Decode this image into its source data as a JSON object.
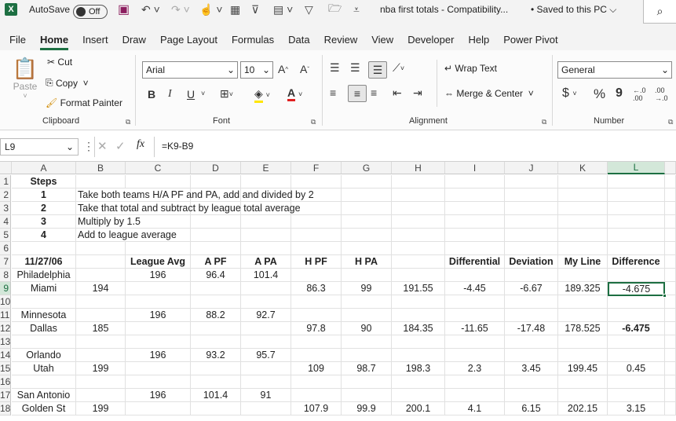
{
  "titlebar": {
    "logo": "X",
    "autosave_label": "AutoSave",
    "autosave_state": "Off",
    "doc_title": "nba first totals  -  Compatibility...",
    "saved_status": "• Saved to this PC",
    "icons": [
      "save-icon",
      "undo-icon",
      "redo-icon",
      "touch-mode-icon",
      "form-icon",
      "filter-clear-icon",
      "sort-icon",
      "filter-icon",
      "open-icon",
      "customize-icon",
      "search-icon"
    ]
  },
  "menu": {
    "tabs": [
      "File",
      "Home",
      "Insert",
      "Draw",
      "Page Layout",
      "Formulas",
      "Data",
      "Review",
      "View",
      "Developer",
      "Help",
      "Power Pivot"
    ],
    "active": "Home"
  },
  "ribbon": {
    "clipboard": {
      "paste": "Paste",
      "cut": "Cut",
      "copy": "Copy",
      "format_painter": "Format Painter",
      "group": "Clipboard"
    },
    "font": {
      "name": "Arial",
      "size": "10",
      "group": "Font",
      "bold": "B",
      "italic": "I",
      "underline": "U",
      "grow": "A^",
      "shrink": "Aˇ"
    },
    "alignment": {
      "wrap": "Wrap Text",
      "merge": "Merge & Center",
      "group": "Alignment"
    },
    "number": {
      "format": "General",
      "currency": "$",
      "percent": "%",
      "comma": "9",
      "inc": ".0→.00",
      "dec": ".00→.0",
      "group": "Number"
    }
  },
  "formula_bar": {
    "name_box": "L9",
    "fx": "fx",
    "formula": "=K9-B9"
  },
  "columns": [
    "A",
    "B",
    "C",
    "D",
    "E",
    "F",
    "G",
    "H",
    "I",
    "J",
    "K",
    "L"
  ],
  "selected_column": "L",
  "rows": [
    "1",
    "2",
    "3",
    "4",
    "5",
    "6",
    "7",
    "8",
    "9",
    "10",
    "11",
    "12",
    "13",
    "14",
    "15",
    "16",
    "17",
    "18"
  ],
  "selected_row": "9",
  "cells": {
    "r1": {
      "A": "Steps"
    },
    "r2": {
      "A": "1",
      "B": "Take both teams H/A PF and PA, add and divided by 2"
    },
    "r3": {
      "A": "2",
      "B": "Take that total and subtract by league total average"
    },
    "r4": {
      "A": "3",
      "B": "Multiply by 1.5"
    },
    "r5": {
      "A": "4",
      "B": "Add to league average"
    },
    "r7": {
      "A": "11/27/06",
      "C": "League Avg",
      "D": "A PF",
      "E": "A PA",
      "F": "H PF",
      "G": "H PA",
      "I": "Differential",
      "J": "Deviation",
      "K": "My Line",
      "L": "Difference"
    },
    "r8": {
      "A": "Philadelphia",
      "C": "196",
      "D": "96.4",
      "E": "101.4"
    },
    "r9": {
      "A": "Miami",
      "B": "194",
      "F": "86.3",
      "G": "99",
      "H": "191.55",
      "I": "-4.45",
      "J": "-6.67",
      "K": "189.325",
      "L": "-4.675"
    },
    "r11": {
      "A": "Minnesota",
      "C": "196",
      "D": "88.2",
      "E": "92.7"
    },
    "r12": {
      "A": "Dallas",
      "B": "185",
      "F": "97.8",
      "G": "90",
      "H": "184.35",
      "I": "-11.65",
      "J": "-17.48",
      "K": "178.525",
      "L": "-6.475"
    },
    "r14": {
      "A": "Orlando",
      "C": "196",
      "D": "93.2",
      "E": "95.7"
    },
    "r15": {
      "A": "Utah",
      "B": "199",
      "F": "109",
      "G": "98.7",
      "H": "198.3",
      "I": "2.3",
      "J": "3.45",
      "K": "199.45",
      "L": "0.45"
    },
    "r17": {
      "A": "San Antonio",
      "C": "196",
      "D": "101.4",
      "E": "91"
    },
    "r18": {
      "A": "Golden St",
      "B": "199",
      "F": "107.9",
      "G": "99.9",
      "H": "200.1",
      "I": "4.1",
      "J": "6.15",
      "K": "202.15",
      "L": "3.15"
    }
  },
  "accent_color": "#1d6f42"
}
